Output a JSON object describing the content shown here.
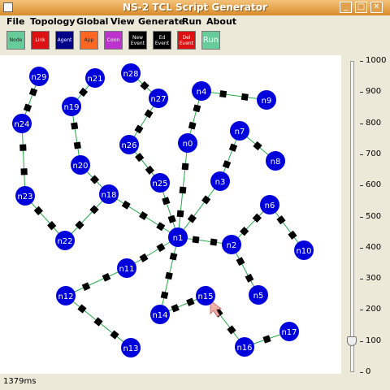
{
  "window": {
    "title": "NS-2 TCL Script Generator"
  },
  "menu": [
    "File",
    "Topology",
    "Global",
    "View",
    "Generate",
    "Run",
    "About"
  ],
  "toolbar": [
    {
      "label": "Node",
      "color": "#66cc99"
    },
    {
      "label": "Link",
      "color": "#dd1111"
    },
    {
      "label": "Agent",
      "color": "#000088"
    },
    {
      "label": "App",
      "color": "#ff6622"
    },
    {
      "label": "Conn",
      "color": "#bb33cc"
    },
    {
      "label": "New Event",
      "color": "#000000"
    },
    {
      "label": "Ed Event",
      "color": "#000000"
    },
    {
      "label": "Del Event",
      "color": "#dd1111"
    },
    {
      "label": "Run",
      "color": "#66cc99",
      "text_color": "#ffffff"
    }
  ],
  "slider": {
    "ticks": [
      "1000",
      "900",
      "800",
      "700",
      "600",
      "500",
      "400",
      "300",
      "200",
      "100",
      "0"
    ],
    "value": 100
  },
  "status": "1379ms",
  "colors": {
    "node": "#0000dd",
    "link": "#22aa44",
    "packet": "#000000"
  },
  "nodes": [
    {
      "id": "n0"
    },
    {
      "id": "n1"
    },
    {
      "id": "n2"
    },
    {
      "id": "n3"
    },
    {
      "id": "n4"
    },
    {
      "id": "n5"
    },
    {
      "id": "n6"
    },
    {
      "id": "n7"
    },
    {
      "id": "n8"
    },
    {
      "id": "n9"
    },
    {
      "id": "n10"
    },
    {
      "id": "n11"
    },
    {
      "id": "n12"
    },
    {
      "id": "n13"
    },
    {
      "id": "n14"
    },
    {
      "id": "n15"
    },
    {
      "id": "n16"
    },
    {
      "id": "n17"
    },
    {
      "id": "n18"
    },
    {
      "id": "n19"
    },
    {
      "id": "n20"
    },
    {
      "id": "n21"
    },
    {
      "id": "n22"
    },
    {
      "id": "n23"
    },
    {
      "id": "n24"
    },
    {
      "id": "n25"
    },
    {
      "id": "n26"
    },
    {
      "id": "n27"
    },
    {
      "id": "n28"
    },
    {
      "id": "n29"
    }
  ],
  "links": [
    [
      "n1",
      "n0"
    ],
    [
      "n0",
      "n4"
    ],
    [
      "n4",
      "n9"
    ],
    [
      "n1",
      "n3"
    ],
    [
      "n3",
      "n7"
    ],
    [
      "n7",
      "n8"
    ],
    [
      "n1",
      "n2"
    ],
    [
      "n2",
      "n6"
    ],
    [
      "n6",
      "n10"
    ],
    [
      "n2",
      "n5"
    ],
    [
      "n1",
      "n11"
    ],
    [
      "n11",
      "n12"
    ],
    [
      "n12",
      "n13"
    ],
    [
      "n1",
      "n14"
    ],
    [
      "n14",
      "n15"
    ],
    [
      "n15",
      "n16"
    ],
    [
      "n16",
      "n17"
    ],
    [
      "n1",
      "n18"
    ],
    [
      "n18",
      "n22"
    ],
    [
      "n22",
      "n23"
    ],
    [
      "n23",
      "n24"
    ],
    [
      "n24",
      "n29"
    ],
    [
      "n1",
      "n25"
    ],
    [
      "n25",
      "n26"
    ],
    [
      "n26",
      "n27"
    ],
    [
      "n27",
      "n28"
    ],
    [
      "n18",
      "n20"
    ],
    [
      "n20",
      "n19"
    ],
    [
      "n19",
      "n21"
    ]
  ]
}
